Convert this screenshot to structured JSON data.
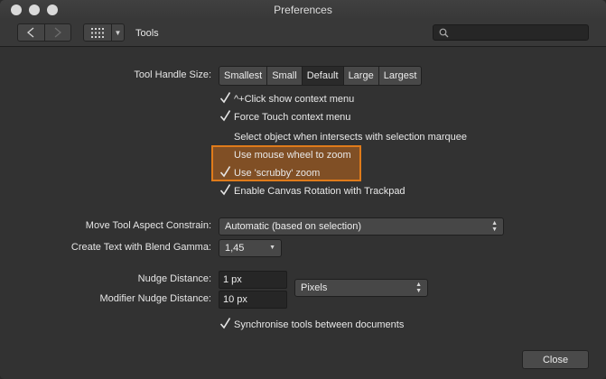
{
  "window": {
    "title": "Preferences"
  },
  "toolbar": {
    "section_title": "Tools",
    "search_placeholder": ""
  },
  "tool_handle_size": {
    "label": "Tool Handle Size:",
    "options": [
      "Smallest",
      "Small",
      "Default",
      "Large",
      "Largest"
    ],
    "selected": "Default"
  },
  "checkboxes": [
    {
      "label": "^+Click show context menu",
      "checked": true
    },
    {
      "label": "Force Touch context menu",
      "checked": true
    },
    {
      "label": "Select object when intersects with selection marquee",
      "checked": false
    },
    {
      "label": "Use mouse wheel to zoom",
      "checked": false,
      "highlighted": true
    },
    {
      "label": "Use 'scrubby' zoom",
      "checked": true,
      "highlighted": true
    },
    {
      "label": "Enable Canvas Rotation with Trackpad",
      "checked": true
    }
  ],
  "move_tool": {
    "label": "Move Tool Aspect Constrain:",
    "value": "Automatic (based on selection)"
  },
  "blend_gamma": {
    "label": "Create Text with Blend Gamma:",
    "value": "1,45"
  },
  "nudge": {
    "label": "Nudge Distance:",
    "value": "1 px"
  },
  "modifier_nudge": {
    "label": "Modifier Nudge Distance:",
    "value": "10 px"
  },
  "units": {
    "value": "Pixels"
  },
  "sync": {
    "label": "Synchronise tools between documents",
    "checked": true
  },
  "footer": {
    "close_label": "Close"
  },
  "colors": {
    "highlight_border": "#e07b1a",
    "window_bg": "#323232"
  }
}
